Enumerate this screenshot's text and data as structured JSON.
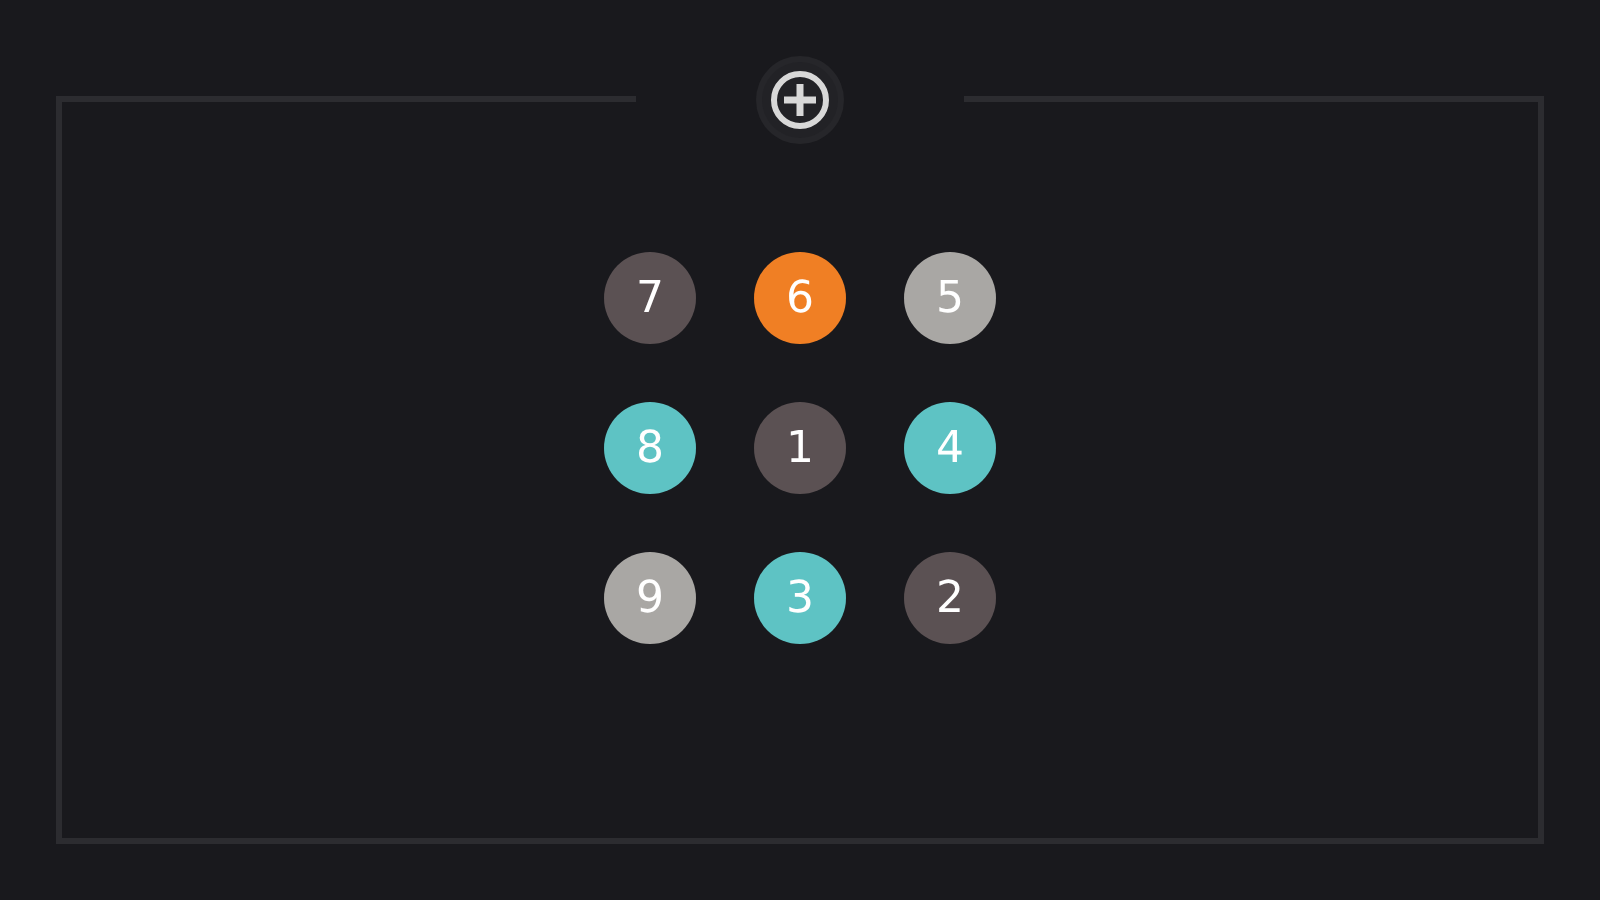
{
  "add_button": {
    "kind": "plus"
  },
  "tiles": [
    {
      "label": "7",
      "color": "#5b5153"
    },
    {
      "label": "6",
      "color": "#f07f24"
    },
    {
      "label": "5",
      "color": "#a9a7a4"
    },
    {
      "label": "8",
      "color": "#5ec3c4"
    },
    {
      "label": "1",
      "color": "#5b5153"
    },
    {
      "label": "4",
      "color": "#5ec3c4"
    },
    {
      "label": "9",
      "color": "#a9a7a4"
    },
    {
      "label": "3",
      "color": "#5ec3c4"
    },
    {
      "label": "2",
      "color": "#5b5153"
    }
  ]
}
